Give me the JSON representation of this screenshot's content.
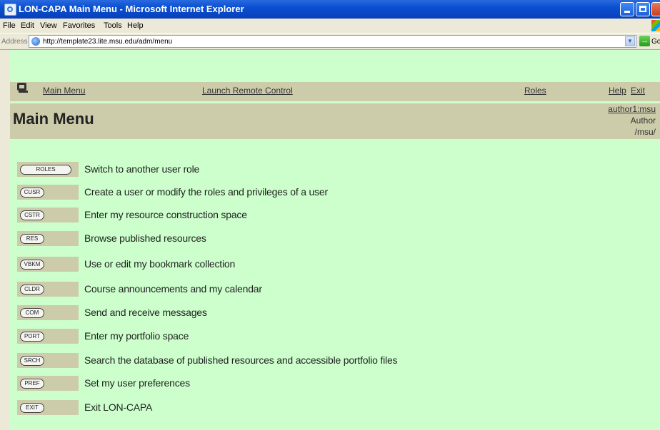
{
  "window": {
    "title": "LON-CAPA Main Menu - Microsoft Internet Explorer"
  },
  "menubar": {
    "items": [
      "File",
      "Edit",
      "View",
      "Favorites",
      "Tools",
      "Help"
    ]
  },
  "addressbar": {
    "label": "Address",
    "url": "http://template23.lite.msu.edu/adm/menu",
    "go_label": "Go"
  },
  "nav": {
    "main_menu": "Main Menu",
    "remote": "Launch Remote Control",
    "roles": "Roles",
    "help": "Help",
    "exit": "Exit"
  },
  "header": {
    "title": "Main Menu",
    "user": "author1:msu",
    "role": "Author",
    "domain": "/msu/"
  },
  "menu_items": [
    {
      "button": "ROLES",
      "label": "Switch to another user role"
    },
    {
      "button": "CUSR",
      "label": "Create a user or modify the roles and privileges of a user"
    },
    {
      "button": "CSTR",
      "label": "Enter my resource construction space"
    },
    {
      "button": "RES",
      "label": "Browse published resources"
    },
    {
      "button": "VBKM",
      "label": "Use or edit my bookmark collection"
    },
    {
      "button": "CLDR",
      "label": "Course announcements and my calendar"
    },
    {
      "button": "COM",
      "label": "Send and receive messages"
    },
    {
      "button": "PORT",
      "label": "Enter my portfolio space"
    },
    {
      "button": "SRCH",
      "label": "Search the database of published resources and accessible portfolio files"
    },
    {
      "button": "PREF",
      "label": "Set my user preferences"
    },
    {
      "button": "EXIT",
      "label": "Exit LON-CAPA"
    }
  ]
}
